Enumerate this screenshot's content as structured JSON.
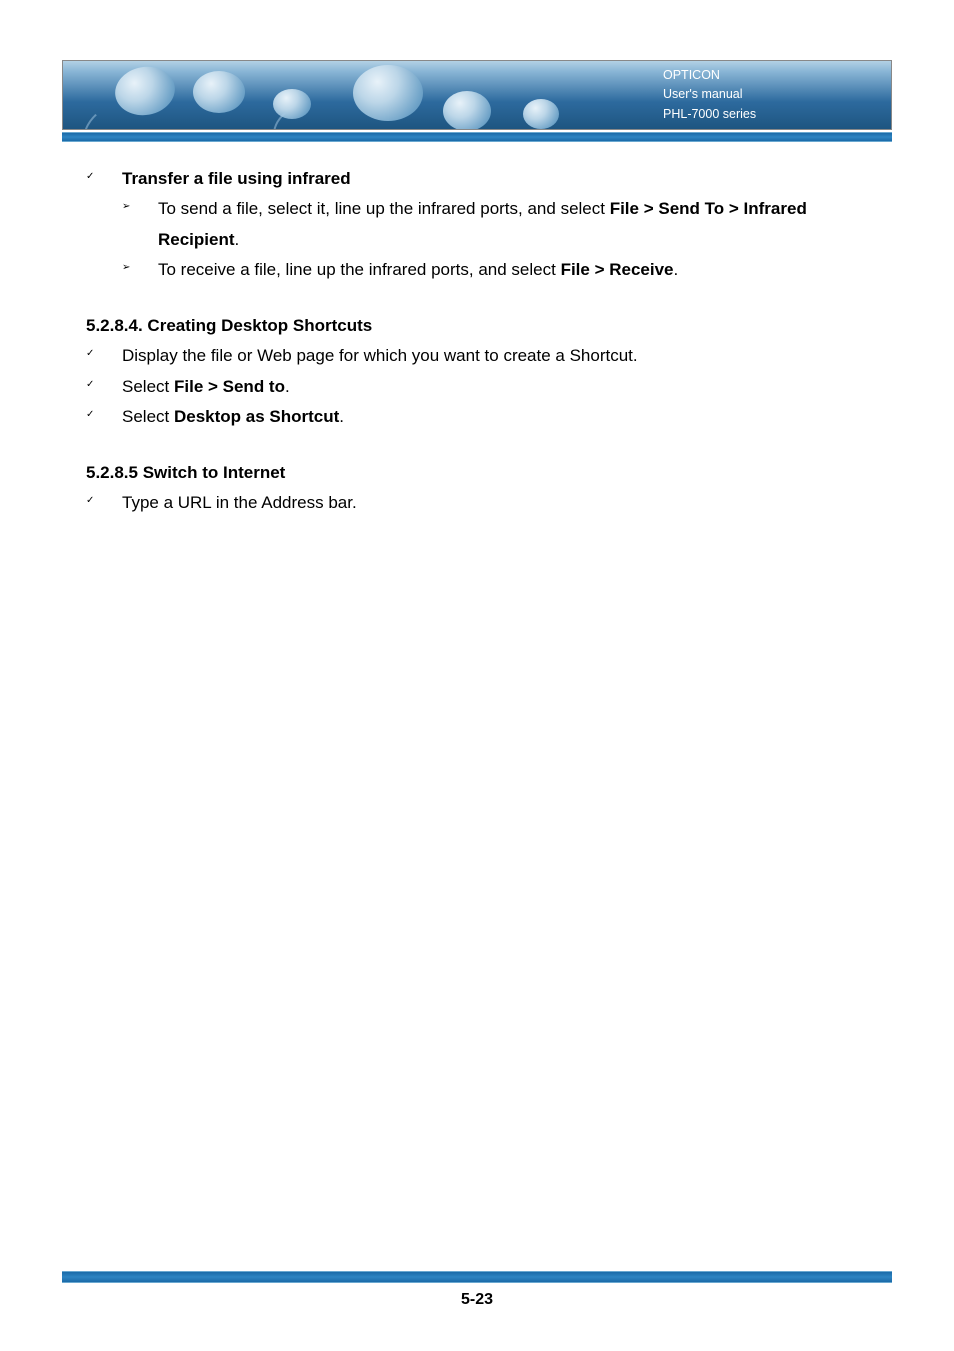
{
  "header": {
    "line1": "OPTICON",
    "line2": "User's manual",
    "line3": "PHL-7000 series"
  },
  "content": {
    "s1": {
      "title": "Transfer a file using infrared",
      "i1a": "To send a file, select it, line up the infrared ports, and select ",
      "i1b": "File > Send To > Infrared Recipient",
      "i1c": ".",
      "i2a": "To receive a file, line up the infrared ports, and select ",
      "i2b": "File > Receive",
      "i2c": "."
    },
    "s2": {
      "heading": "5.2.8.4. Creating Desktop Shortcuts",
      "i1": "Display the file or Web page for which you want to create a Shortcut.",
      "i2a": "Select ",
      "i2b": "File > Send to",
      "i2c": ".",
      "i3a": "Select ",
      "i3b": "Desktop as Shortcut",
      "i3c": "."
    },
    "s3": {
      "heading": "5.2.8.5 Switch to Internet",
      "i1": "Type a URL in the Address bar."
    }
  },
  "footer": {
    "page": "5-23"
  },
  "bullets": {
    "check": "✓",
    "tri": "➢"
  }
}
